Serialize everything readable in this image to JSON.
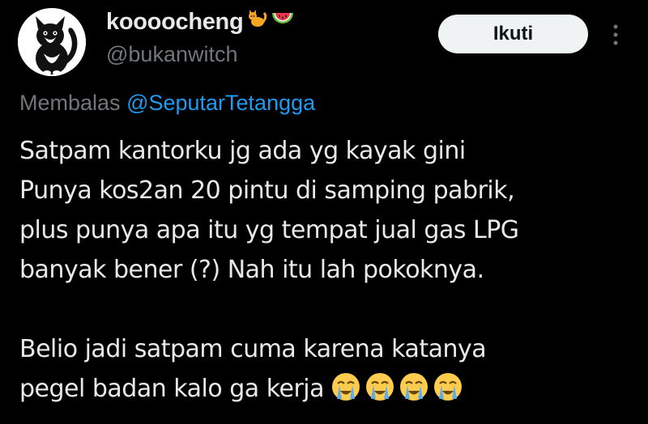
{
  "user": {
    "display_name": "koooocheng",
    "handle": "@bukanwitch",
    "badges": [
      "cat-emoji",
      "watermelon-emoji"
    ]
  },
  "follow_button_label": "Ikuti",
  "reply": {
    "prefix": "Membalas",
    "mention": "@SeputarTetangga"
  },
  "tweet": {
    "paragraph1": [
      "Satpam kantorku jg ada yg kayak gini",
      "Punya kos2an 20 pintu di samping pabrik,",
      "plus punya apa itu yg tempat jual gas LPG",
      "banyak bener (?) Nah itu lah pokoknya."
    ],
    "paragraph2": [
      "Belio jadi satpam cuma karena katanya",
      "pegel badan kalo ga kerja"
    ],
    "trailing_emoji": [
      "loudly-crying-face",
      "loudly-crying-face",
      "loudly-crying-face",
      "loudly-crying-face"
    ]
  },
  "colors": {
    "background": "#000000",
    "text": "#e7e9ea",
    "secondary": "#71767b",
    "link": "#1d9bf0",
    "button_bg": "#eff3f4"
  }
}
